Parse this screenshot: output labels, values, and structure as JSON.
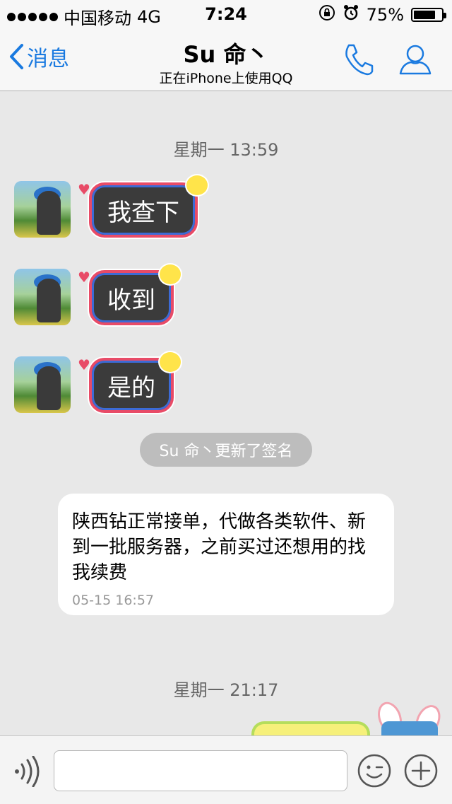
{
  "status_bar": {
    "carrier": "中国移动",
    "network": "4G",
    "time": "7:24",
    "battery": "75%",
    "battery_level": 0.75
  },
  "nav": {
    "back_label": "消息",
    "title": "Su 命丶",
    "subtitle": "正在iPhone上使用QQ",
    "accent": "#1a7ae0"
  },
  "chat": {
    "time_1": "星期一 13:59",
    "messages": [
      {
        "text": "我查下"
      },
      {
        "text": "收到"
      },
      {
        "text": "是的"
      }
    ],
    "system_notice": "Su 命丶更新了签名",
    "signature_card": {
      "text": "陕西钻正常接单，代做各类软件、新到一批服务器，之前买过还想用的找我续费",
      "timestamp": "05-15 16:57"
    },
    "time_2": "星期一 21:17"
  },
  "input_bar": {
    "value": ""
  }
}
